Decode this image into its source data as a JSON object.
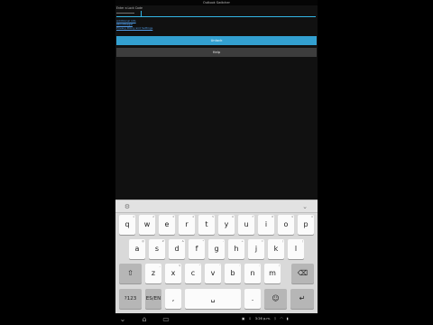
{
  "app": {
    "title": "Outlook Switcher"
  },
  "form": {
    "field_label": "Enter a Lock Code",
    "password_value": "••••••••••",
    "links": [
      "Additional info",
      "About/Legal",
      "Privacy Policy and Settings"
    ],
    "unlock_label": "Unlock",
    "help_label": "Help"
  },
  "keyboard": {
    "settings_icon": "settings-icon",
    "collapse_icon": "chevron-down-icon",
    "row1": [
      {
        "label": "q",
        "hint": "1"
      },
      {
        "label": "w",
        "hint": "2"
      },
      {
        "label": "e",
        "hint": "3"
      },
      {
        "label": "r",
        "hint": "4"
      },
      {
        "label": "t",
        "hint": "5"
      },
      {
        "label": "y",
        "hint": "6"
      },
      {
        "label": "u",
        "hint": "7"
      },
      {
        "label": "i",
        "hint": "8"
      },
      {
        "label": "o",
        "hint": "9"
      },
      {
        "label": "p",
        "hint": "0"
      }
    ],
    "row2": [
      {
        "label": "a",
        "hint": "@"
      },
      {
        "label": "s",
        "hint": "#"
      },
      {
        "label": "d",
        "hint": "&"
      },
      {
        "label": "f",
        "hint": "*"
      },
      {
        "label": "g",
        "hint": "-"
      },
      {
        "label": "h",
        "hint": "+"
      },
      {
        "label": "j",
        "hint": "="
      },
      {
        "label": "k",
        "hint": "("
      },
      {
        "label": "l",
        "hint": ")"
      }
    ],
    "row3": [
      {
        "label": "z",
        "hint": "_"
      },
      {
        "label": "x",
        "hint": "$"
      },
      {
        "label": "c",
        "hint": "\""
      },
      {
        "label": "v",
        "hint": "'"
      },
      {
        "label": "b",
        "hint": ":"
      },
      {
        "label": "n",
        "hint": ";"
      },
      {
        "label": "m",
        "hint": "/"
      }
    ],
    "shift_label": "⇧",
    "backspace_label": "⌫",
    "symbols_label": "?123",
    "lang_label": "ES/EN",
    "comma_label": ",",
    "space_label": "␣",
    "period_label": ".",
    "emoji_label": "☺",
    "enter_label": "↵"
  },
  "status_bar": {
    "time": "3:26 p.m.",
    "nav_icons": [
      "chevron-down-icon",
      "home-icon",
      "recents-icon"
    ],
    "status_icons": [
      "screenshot-icon",
      "download-icon",
      "bluetooth-icon",
      "wifi-icon",
      "battery-icon"
    ]
  }
}
